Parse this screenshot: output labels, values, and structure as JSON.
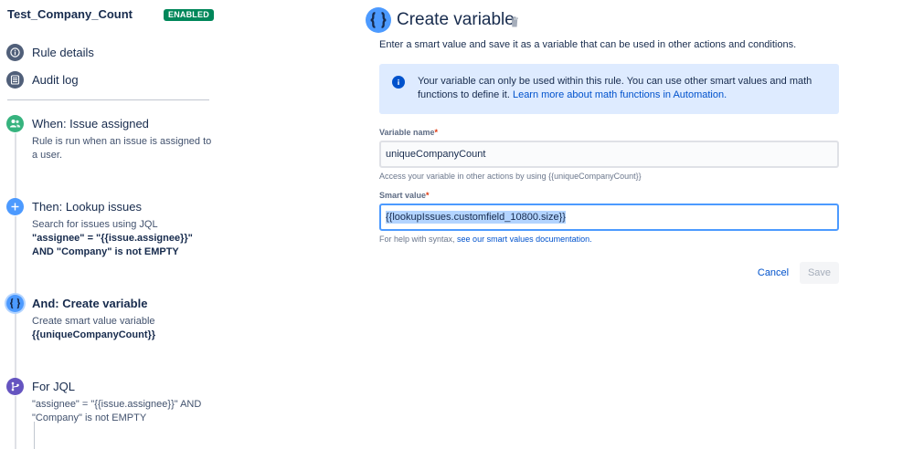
{
  "sidebar": {
    "rule_name": "Test_Company_Count",
    "status_badge": "ENABLED",
    "nav": [
      {
        "label": "Rule details"
      },
      {
        "label": "Audit log"
      }
    ],
    "steps": [
      {
        "title": "When: Issue assigned",
        "desc": "Rule is run when an issue is assigned to a user."
      },
      {
        "title": "Then: Lookup issues",
        "desc_prefix": "Search for issues using JQL",
        "desc_bold": "\"assignee\" = \"{{issue.assignee}}\" AND \"Company\" is not EMPTY"
      },
      {
        "title": "And: Create variable",
        "desc_prefix": "Create smart value variable",
        "desc_bold": "{{uniqueCompanyCount}}"
      },
      {
        "title": "For JQL",
        "desc": "\"assignee\" = \"{{issue.assignee}}\" AND \"Company\" is not EMPTY"
      }
    ]
  },
  "main": {
    "title": "Create variable",
    "subtitle": "Enter a smart value and save it as a variable that can be used in other actions and conditions.",
    "info": {
      "text": "Your variable can only be used within this rule. You can use other smart values and math functions to define it. ",
      "link": "Learn more about math functions in Automation."
    },
    "variable_name": {
      "label": "Variable name",
      "required_mark": "*",
      "value": "uniqueCompanyCount",
      "helper": "Access your variable in other actions by using {{uniqueCompanyCount}}"
    },
    "smart_value": {
      "label": "Smart value",
      "required_mark": "*",
      "value": "{{lookupIssues.customfield_10800.size}}",
      "helper_prefix": "For help with syntax, ",
      "helper_link": "see our smart values documentation."
    },
    "buttons": {
      "cancel": "Cancel",
      "save": "Save"
    }
  },
  "colors": {
    "enabled_badge": "#00875a",
    "trigger_icon": "#36b37e",
    "action_icon": "#4c9aff",
    "branch_icon": "#6554c0",
    "link": "#0052cc",
    "info_bg": "#deebff"
  }
}
